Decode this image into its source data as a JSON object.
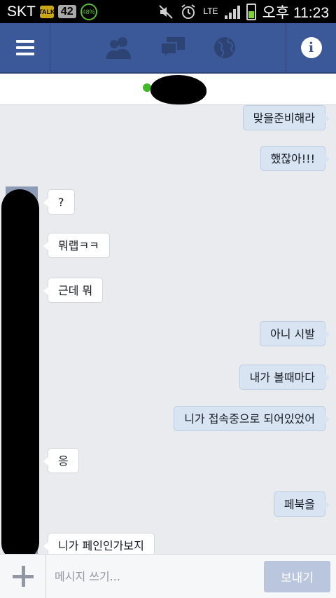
{
  "status_bar": {
    "carrier": "SKT",
    "talk_icon": "talk-icon",
    "notification_count": "42",
    "battery_ring": "48%",
    "network": "LTE",
    "time": "오후 11:23"
  },
  "nav": {
    "menu_icon": "hamburger-icon",
    "icons": [
      "friends-icon",
      "messages-icon",
      "globe-icon"
    ],
    "info_icon": "info-icon",
    "colors": {
      "bar": "#3b5998",
      "icon_inactive": "#2d4373"
    }
  },
  "conversation": {
    "contact_name": "",
    "online_color": "#42b72a",
    "messages": [
      {
        "direction": "out",
        "text": "맞을준비해라"
      },
      {
        "direction": "out",
        "text": "했잖아!!!"
      },
      {
        "direction": "in",
        "text": "?"
      },
      {
        "direction": "in",
        "text": "뭐랩ㅋㅋ"
      },
      {
        "direction": "in",
        "text": "근데 뭐"
      },
      {
        "direction": "out",
        "text": "아니 시발"
      },
      {
        "direction": "out",
        "text": "내가 볼때마다"
      },
      {
        "direction": "out",
        "text": "니가 접속중으로 되어있었어"
      },
      {
        "direction": "in",
        "text": "응"
      },
      {
        "direction": "out",
        "text": "페북을"
      },
      {
        "direction": "in",
        "text": "니가 페인인가보지"
      }
    ]
  },
  "composer": {
    "placeholder": "메시지 쓰기...",
    "send_label": "보내기"
  }
}
